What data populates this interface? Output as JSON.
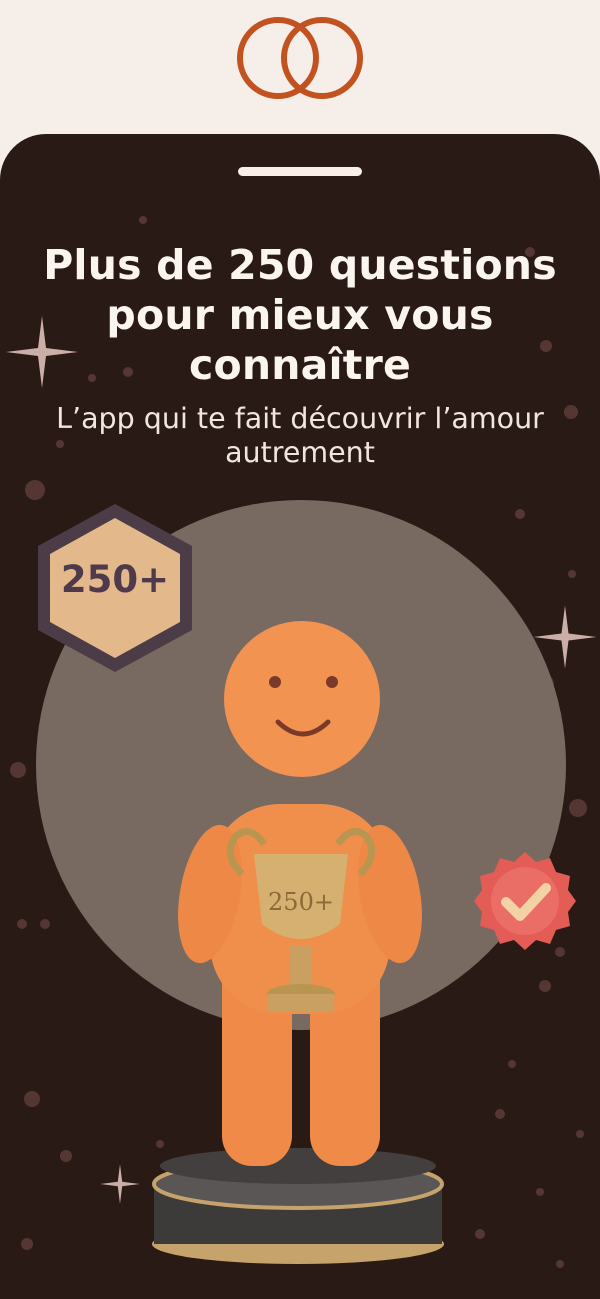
{
  "logo": {
    "icon": "interlocked-rings-icon",
    "color": "#c2521f"
  },
  "card": {
    "title": "Plus de 250 questions pour mieux vous connaître",
    "subtitle": "L’app qui te fait découvrir l’amour autrement",
    "badge_label": "250+",
    "trophy_label": "250+",
    "colors": {
      "background": "#2a1a16",
      "circle": "#786a61",
      "figure": "#f08c45",
      "accent": "#c2521f"
    }
  }
}
